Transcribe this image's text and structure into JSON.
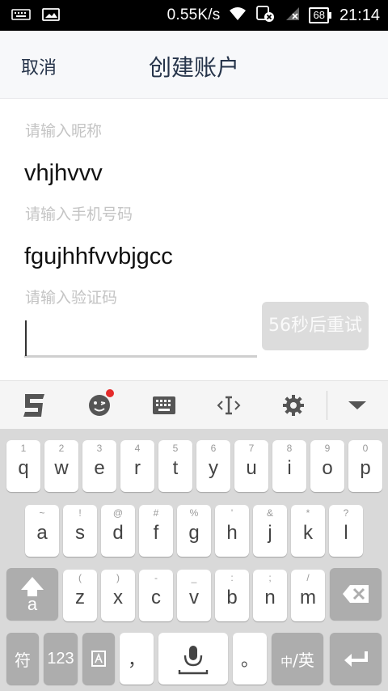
{
  "status_bar": {
    "icons_left": [
      "keyboard-icon",
      "image-icon"
    ],
    "net_speed": "0.55K/s",
    "icons_right": [
      "wifi-icon",
      "sim-error-icon",
      "no-signal-icon"
    ],
    "battery": "68",
    "time": "21:14"
  },
  "header": {
    "cancel_label": "取消",
    "title": "创建账户"
  },
  "form": {
    "nickname_placeholder": "请输入昵称",
    "nickname_value": "vhjhvvv",
    "phone_placeholder": "请输入手机号码",
    "phone_value": "fgujhhfvvbjgcc",
    "code_placeholder": "请输入验证码",
    "code_value": "",
    "resend_label": "56秒后重试"
  },
  "keyboard_toolbar": {
    "items": [
      "sogou-logo-icon",
      "emoji-icon",
      "keyboard-layout-icon",
      "cursor-move-icon",
      "settings-gear-icon",
      "collapse-keyboard-icon"
    ],
    "emoji_has_notification": true
  },
  "keyboard": {
    "row1": [
      {
        "hint": "1",
        "key": "q"
      },
      {
        "hint": "2",
        "key": "w"
      },
      {
        "hint": "3",
        "key": "e"
      },
      {
        "hint": "4",
        "key": "r"
      },
      {
        "hint": "5",
        "key": "t"
      },
      {
        "hint": "6",
        "key": "y"
      },
      {
        "hint": "7",
        "key": "u"
      },
      {
        "hint": "8",
        "key": "i"
      },
      {
        "hint": "9",
        "key": "o"
      },
      {
        "hint": "0",
        "key": "p"
      }
    ],
    "row2": [
      {
        "hint": "~",
        "key": "a"
      },
      {
        "hint": "!",
        "key": "s"
      },
      {
        "hint": "@",
        "key": "d"
      },
      {
        "hint": "#",
        "key": "f"
      },
      {
        "hint": "%",
        "key": "g"
      },
      {
        "hint": "'",
        "key": "h"
      },
      {
        "hint": "&",
        "key": "j"
      },
      {
        "hint": "*",
        "key": "k"
      },
      {
        "hint": "?",
        "key": "l"
      }
    ],
    "row3": [
      {
        "hint": "(",
        "key": "z"
      },
      {
        "hint": ")",
        "key": "x"
      },
      {
        "hint": "-",
        "key": "c"
      },
      {
        "hint": "_",
        "key": "v"
      },
      {
        "hint": ":",
        "key": "b"
      },
      {
        "hint": ";",
        "key": "n"
      },
      {
        "hint": "/",
        "key": "m"
      }
    ],
    "shift_label": "a",
    "symbols_label": "符",
    "numbers_label": "123",
    "comma_label": "，",
    "period_label": "。",
    "lang_small": "中",
    "lang_label": "/英"
  },
  "colors": {
    "header_bg": "#f7f8fa",
    "title_text": "#26344a",
    "placeholder": "#c4c4c4",
    "resend_bg": "#dcdcdc",
    "keyboard_bg": "#d9d9d9",
    "dark_key": "#adadad",
    "notification_dot": "#e52b2b"
  }
}
